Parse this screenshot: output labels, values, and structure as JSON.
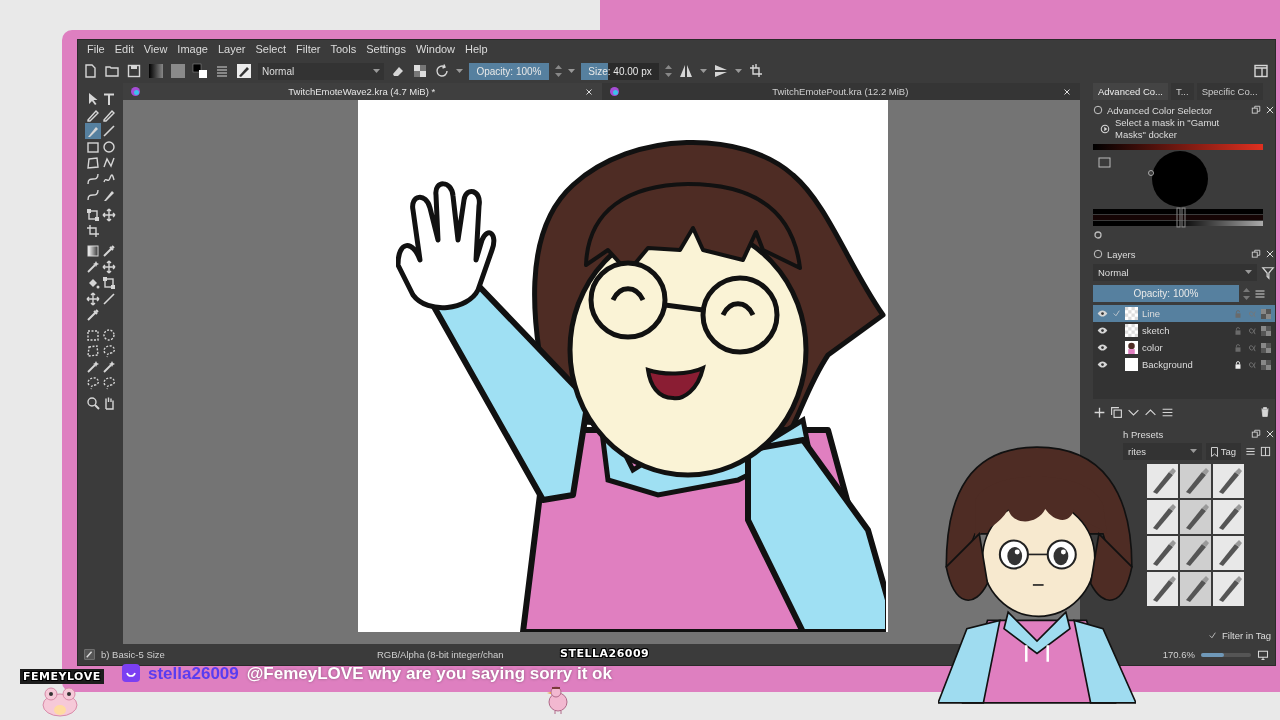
{
  "menu": [
    "File",
    "Edit",
    "View",
    "Image",
    "Layer",
    "Select",
    "Filter",
    "Tools",
    "Settings",
    "Window",
    "Help"
  ],
  "toolbar": {
    "blend_mode": "Normal",
    "opacity": {
      "label": "Opacity: 100%",
      "level": 1
    },
    "size": {
      "label": "Size: 40.00 px",
      "level": 0.35
    }
  },
  "tool_groups": [
    [
      {
        "kind": "pointer",
        "selected": false
      },
      {
        "kind": "text",
        "selected": false
      },
      {
        "kind": "pen",
        "selected": false
      },
      {
        "kind": "pen",
        "selected": false
      },
      {
        "kind": "brush",
        "selected": true
      },
      {
        "kind": "line",
        "selected": false
      },
      {
        "kind": "rectangle",
        "selected": false
      },
      {
        "kind": "ellipse",
        "selected": false
      },
      {
        "kind": "polygon",
        "selected": false
      },
      {
        "kind": "polyline",
        "selected": false
      },
      {
        "kind": "curve",
        "selected": false
      },
      {
        "kind": "freehand",
        "selected": false
      },
      {
        "kind": "curve",
        "selected": false
      },
      {
        "kind": "brush",
        "selected": false
      }
    ],
    [
      {
        "kind": "transform",
        "selected": false
      },
      {
        "kind": "move",
        "selected": false
      },
      {
        "kind": "crop",
        "selected": false
      }
    ],
    [
      {
        "kind": "gradient",
        "selected": false
      },
      {
        "kind": "eyedropper",
        "selected": false
      },
      {
        "kind": "wand",
        "selected": false
      },
      {
        "kind": "move",
        "selected": false
      },
      {
        "kind": "fill",
        "selected": false
      },
      {
        "kind": "transform",
        "selected": false
      },
      {
        "kind": "move",
        "selected": false
      },
      {
        "kind": "line",
        "selected": false
      },
      {
        "kind": "eyedropper",
        "selected": false
      }
    ],
    [
      {
        "kind": "dashed_rectangle",
        "selected": false
      },
      {
        "kind": "dashed_ellipse",
        "selected": false
      },
      {
        "kind": "dashed_polygon",
        "selected": false
      },
      {
        "kind": "lasso",
        "selected": false
      },
      {
        "kind": "wand",
        "selected": false
      },
      {
        "kind": "wand",
        "selected": false
      },
      {
        "kind": "lasso",
        "selected": false
      },
      {
        "kind": "lasso",
        "selected": false
      }
    ],
    [
      {
        "kind": "zoom",
        "selected": false
      },
      {
        "kind": "hand",
        "selected": false
      }
    ]
  ],
  "documents": [
    {
      "title": "TwitchEmoteWave2.kra (4.7 MiB) *",
      "selected": true
    },
    {
      "title": "TwitchEmotePout.kra (12.2 MiB)",
      "selected": false
    }
  ],
  "dock_tabs": [
    {
      "label": "Advanced Co...",
      "selected": true
    },
    {
      "label": "T...",
      "selected": false
    },
    {
      "label": "Specific Co...",
      "selected": false
    }
  ],
  "color_selector": {
    "title": "Advanced Color Selector",
    "hint": "Select a mask in \"Gamut Masks\" docker"
  },
  "layers": {
    "title": "Layers",
    "blend_mode": "Normal",
    "opacity": {
      "label": "Opacity:  100%",
      "level": 1
    },
    "items": [
      {
        "name": "Line",
        "selected": true,
        "visible": true,
        "locked": false,
        "kind": "paint"
      },
      {
        "name": "sketch",
        "selected": false,
        "visible": true,
        "locked": false,
        "kind": "paint"
      },
      {
        "name": "color",
        "selected": false,
        "visible": true,
        "locked": false,
        "kind": "picture"
      },
      {
        "name": "Background",
        "selected": false,
        "visible": true,
        "locked": true,
        "kind": "blank"
      }
    ]
  },
  "brush_presets": {
    "title": "h Presets",
    "tag_filter": "rites",
    "tag_button": "Tag",
    "filter_in_tag": {
      "label": "Filter in Tag",
      "checked": true
    }
  },
  "status_bar": {
    "brush": "b) Basic-5 Size",
    "color_space": "RGB/Alpha (8-bit integer/chan",
    "zoom": "170.6%",
    "zoom_slider": {
      "level": 0.45
    }
  },
  "chat": {
    "streamer_label": "FEMEYLOVE",
    "username": "stella26009",
    "message": "@FemeyLOVE why are you saying sorry it ok",
    "viewer_label": "STELLA26009"
  }
}
